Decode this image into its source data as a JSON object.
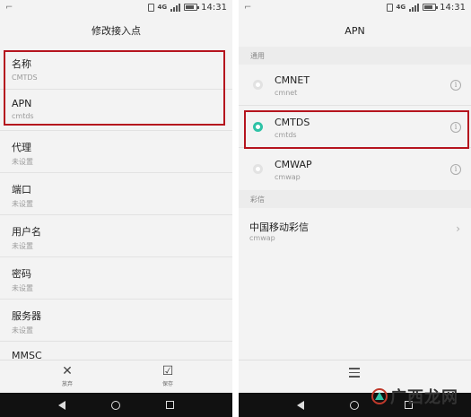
{
  "status_bar": {
    "left_glyph": "⌐",
    "net_top": "4G",
    "net_bottom": "4G",
    "time": "14:31"
  },
  "left_screen": {
    "title": "修改接入点",
    "fields": [
      {
        "label": "名称",
        "value": "CMTDS"
      },
      {
        "label": "APN",
        "value": "cmtds"
      },
      {
        "label": "代理",
        "value": "未设置"
      },
      {
        "label": "端口",
        "value": "未设置"
      },
      {
        "label": "用户名",
        "value": "未设置"
      },
      {
        "label": "密码",
        "value": "未设置"
      },
      {
        "label": "服务器",
        "value": "未设置"
      },
      {
        "label": "MMSC",
        "value": ""
      }
    ],
    "actions": {
      "discard_label": "放弃",
      "save_label": "保存"
    }
  },
  "right_screen": {
    "title": "APN",
    "section_general": "通用",
    "apns": [
      {
        "name": "CMNET",
        "apn": "cmnet",
        "selected": false
      },
      {
        "name": "CMTDS",
        "apn": "cmtds",
        "selected": true
      },
      {
        "name": "CMWAP",
        "apn": "cmwap",
        "selected": false
      }
    ],
    "section_mms": "彩信",
    "mms_apns": [
      {
        "name": "中国移动彩信",
        "apn": "cmwap"
      }
    ]
  },
  "watermark": {
    "text": "广西龙网"
  },
  "colors": {
    "highlight": "#b5141e",
    "radio_selected": "#2ec2a6"
  },
  "icons": {
    "discard": "close-icon",
    "save": "checkbox-check-icon",
    "info": "info-icon",
    "menu": "menu-icon",
    "back": "back-triangle-icon",
    "home": "home-circle-icon",
    "recent": "recent-square-icon"
  }
}
